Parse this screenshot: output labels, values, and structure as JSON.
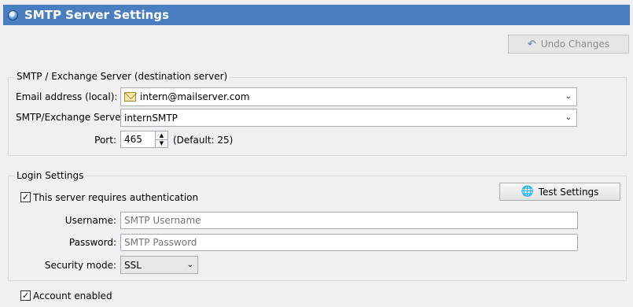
{
  "window": {
    "title": "SMTP Server Settings"
  },
  "toolbar": {
    "undo_label": "Undo Changes",
    "undo_icon": "undo-arrow-icon"
  },
  "smtp_group": {
    "title": "SMTP / Exchange Server (destination server)",
    "email_label": "Email address (local):",
    "email_value": "intern@mailserver.com",
    "server_label": "SMTP/Exchange Server:",
    "server_value": "internSMTP",
    "port_label": "Port:",
    "port_value": "465",
    "port_default": "(Default: 25)"
  },
  "login_group": {
    "title": "Login Settings",
    "requires_auth_label": "This server requires authentication",
    "requires_auth_checked": true,
    "test_button_label": "Test Settings",
    "test_icon": "globe-check-icon",
    "username_label": "Username:",
    "username_placeholder": "SMTP Username",
    "password_label": "Password:",
    "password_placeholder": "SMTP Password",
    "security_label": "Security mode:",
    "security_value": "SSL"
  },
  "account": {
    "enabled_label": "Account enabled",
    "enabled_checked": true
  },
  "colors": {
    "titlebar": "#4a7ec1",
    "background": "#f0f0f0"
  }
}
